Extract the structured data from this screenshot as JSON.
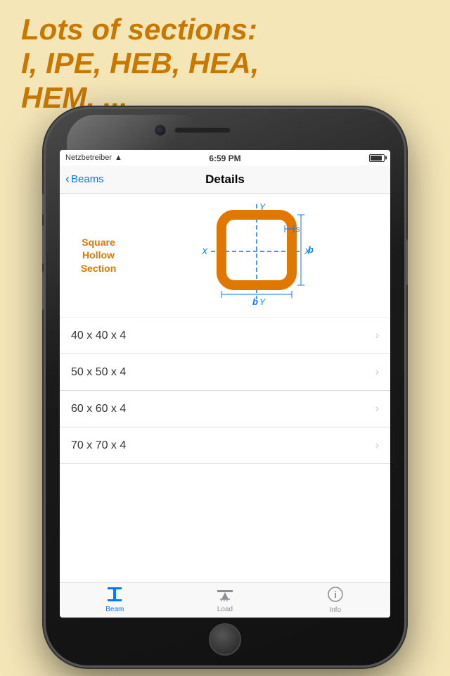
{
  "header": {
    "line1": "Lots of sections:",
    "line2": "I, IPE, HEB, HEA,",
    "line3": "HEM, ..."
  },
  "status_bar": {
    "carrier": "Netzbetreiber",
    "time": "6:59 PM"
  },
  "nav": {
    "back_label": "Beams",
    "title": "Details"
  },
  "diagram": {
    "label": "Square\nHollow\nSection",
    "dimensions": {
      "b_label": "b",
      "s_label": "s",
      "x_label": "X",
      "y_label": "Y"
    }
  },
  "list_items": [
    {
      "label": "40 x 40 x 4"
    },
    {
      "label": "50 x 50 x 4"
    },
    {
      "label": "60 x 60 x 4"
    },
    {
      "label": "70 x 70 x 4"
    }
  ],
  "tab_bar": {
    "tabs": [
      {
        "label": "Beam",
        "active": true
      },
      {
        "label": "Load",
        "active": false
      },
      {
        "label": "Info",
        "active": false
      }
    ]
  },
  "colors": {
    "accent_orange": "#c87800",
    "diagram_orange": "#e07800",
    "ios_blue": "#007aff"
  }
}
